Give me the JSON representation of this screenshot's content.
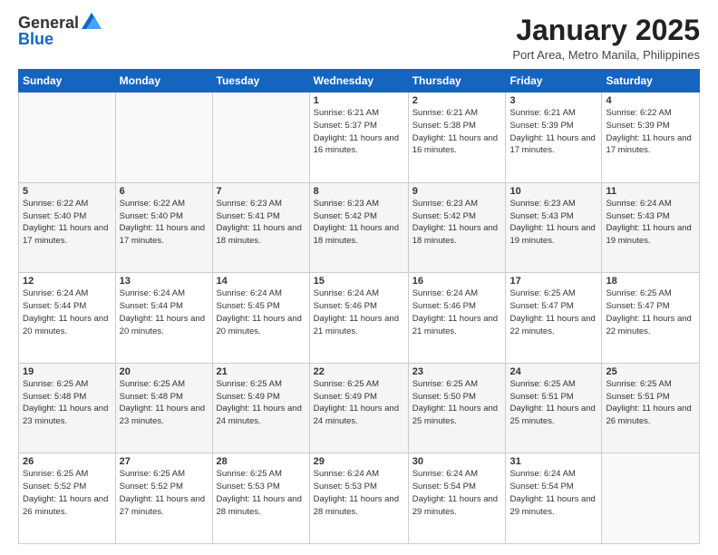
{
  "header": {
    "logo_general": "General",
    "logo_blue": "Blue",
    "title": "January 2025",
    "location": "Port Area, Metro Manila, Philippines"
  },
  "days_of_week": [
    "Sunday",
    "Monday",
    "Tuesday",
    "Wednesday",
    "Thursday",
    "Friday",
    "Saturday"
  ],
  "weeks": [
    [
      {
        "day": "",
        "info": ""
      },
      {
        "day": "",
        "info": ""
      },
      {
        "day": "",
        "info": ""
      },
      {
        "day": "1",
        "info": "Sunrise: 6:21 AM\nSunset: 5:37 PM\nDaylight: 11 hours and 16 minutes."
      },
      {
        "day": "2",
        "info": "Sunrise: 6:21 AM\nSunset: 5:38 PM\nDaylight: 11 hours and 16 minutes."
      },
      {
        "day": "3",
        "info": "Sunrise: 6:21 AM\nSunset: 5:39 PM\nDaylight: 11 hours and 17 minutes."
      },
      {
        "day": "4",
        "info": "Sunrise: 6:22 AM\nSunset: 5:39 PM\nDaylight: 11 hours and 17 minutes."
      }
    ],
    [
      {
        "day": "5",
        "info": "Sunrise: 6:22 AM\nSunset: 5:40 PM\nDaylight: 11 hours and 17 minutes."
      },
      {
        "day": "6",
        "info": "Sunrise: 6:22 AM\nSunset: 5:40 PM\nDaylight: 11 hours and 17 minutes."
      },
      {
        "day": "7",
        "info": "Sunrise: 6:23 AM\nSunset: 5:41 PM\nDaylight: 11 hours and 18 minutes."
      },
      {
        "day": "8",
        "info": "Sunrise: 6:23 AM\nSunset: 5:42 PM\nDaylight: 11 hours and 18 minutes."
      },
      {
        "day": "9",
        "info": "Sunrise: 6:23 AM\nSunset: 5:42 PM\nDaylight: 11 hours and 18 minutes."
      },
      {
        "day": "10",
        "info": "Sunrise: 6:23 AM\nSunset: 5:43 PM\nDaylight: 11 hours and 19 minutes."
      },
      {
        "day": "11",
        "info": "Sunrise: 6:24 AM\nSunset: 5:43 PM\nDaylight: 11 hours and 19 minutes."
      }
    ],
    [
      {
        "day": "12",
        "info": "Sunrise: 6:24 AM\nSunset: 5:44 PM\nDaylight: 11 hours and 20 minutes."
      },
      {
        "day": "13",
        "info": "Sunrise: 6:24 AM\nSunset: 5:44 PM\nDaylight: 11 hours and 20 minutes."
      },
      {
        "day": "14",
        "info": "Sunrise: 6:24 AM\nSunset: 5:45 PM\nDaylight: 11 hours and 20 minutes."
      },
      {
        "day": "15",
        "info": "Sunrise: 6:24 AM\nSunset: 5:46 PM\nDaylight: 11 hours and 21 minutes."
      },
      {
        "day": "16",
        "info": "Sunrise: 6:24 AM\nSunset: 5:46 PM\nDaylight: 11 hours and 21 minutes."
      },
      {
        "day": "17",
        "info": "Sunrise: 6:25 AM\nSunset: 5:47 PM\nDaylight: 11 hours and 22 minutes."
      },
      {
        "day": "18",
        "info": "Sunrise: 6:25 AM\nSunset: 5:47 PM\nDaylight: 11 hours and 22 minutes."
      }
    ],
    [
      {
        "day": "19",
        "info": "Sunrise: 6:25 AM\nSunset: 5:48 PM\nDaylight: 11 hours and 23 minutes."
      },
      {
        "day": "20",
        "info": "Sunrise: 6:25 AM\nSunset: 5:48 PM\nDaylight: 11 hours and 23 minutes."
      },
      {
        "day": "21",
        "info": "Sunrise: 6:25 AM\nSunset: 5:49 PM\nDaylight: 11 hours and 24 minutes."
      },
      {
        "day": "22",
        "info": "Sunrise: 6:25 AM\nSunset: 5:49 PM\nDaylight: 11 hours and 24 minutes."
      },
      {
        "day": "23",
        "info": "Sunrise: 6:25 AM\nSunset: 5:50 PM\nDaylight: 11 hours and 25 minutes."
      },
      {
        "day": "24",
        "info": "Sunrise: 6:25 AM\nSunset: 5:51 PM\nDaylight: 11 hours and 25 minutes."
      },
      {
        "day": "25",
        "info": "Sunrise: 6:25 AM\nSunset: 5:51 PM\nDaylight: 11 hours and 26 minutes."
      }
    ],
    [
      {
        "day": "26",
        "info": "Sunrise: 6:25 AM\nSunset: 5:52 PM\nDaylight: 11 hours and 26 minutes."
      },
      {
        "day": "27",
        "info": "Sunrise: 6:25 AM\nSunset: 5:52 PM\nDaylight: 11 hours and 27 minutes."
      },
      {
        "day": "28",
        "info": "Sunrise: 6:25 AM\nSunset: 5:53 PM\nDaylight: 11 hours and 28 minutes."
      },
      {
        "day": "29",
        "info": "Sunrise: 6:24 AM\nSunset: 5:53 PM\nDaylight: 11 hours and 28 minutes."
      },
      {
        "day": "30",
        "info": "Sunrise: 6:24 AM\nSunset: 5:54 PM\nDaylight: 11 hours and 29 minutes."
      },
      {
        "day": "31",
        "info": "Sunrise: 6:24 AM\nSunset: 5:54 PM\nDaylight: 11 hours and 29 minutes."
      },
      {
        "day": "",
        "info": ""
      }
    ]
  ]
}
